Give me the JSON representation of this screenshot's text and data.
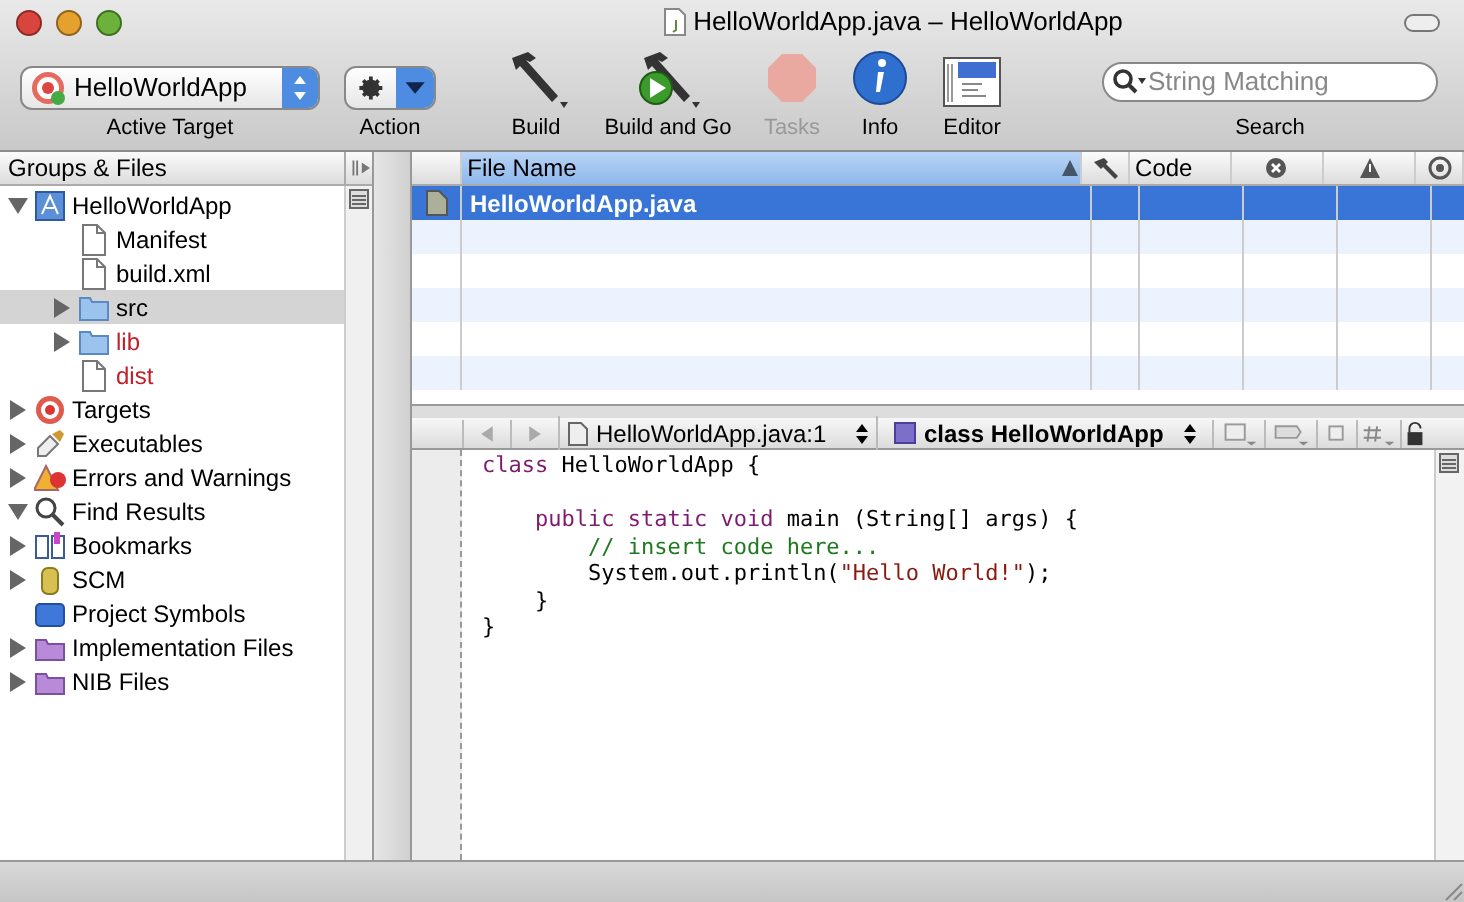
{
  "window": {
    "title": "HelloWorldApp.java – HelloWorldApp"
  },
  "toolbar": {
    "items": [
      {
        "kind": "target_popup",
        "value": "HelloWorldApp",
        "label": "Active Target",
        "disabled": false
      },
      {
        "kind": "action_popup",
        "label": "Action",
        "disabled": false
      },
      {
        "kind": "build",
        "label": "Build",
        "disabled": false
      },
      {
        "kind": "build_go",
        "label": "Build and Go",
        "disabled": false
      },
      {
        "kind": "tasks",
        "label": "Tasks",
        "disabled": true
      },
      {
        "kind": "info",
        "label": "Info",
        "disabled": false
      },
      {
        "kind": "editor",
        "label": "Editor",
        "disabled": false
      },
      {
        "kind": "search",
        "placeholder": "String Matching",
        "label": "Search",
        "disabled": false
      }
    ]
  },
  "sidebar": {
    "title": "Groups & Files",
    "items": [
      {
        "label": "HelloWorldApp",
        "kind": "project",
        "expanded": true,
        "selected": false,
        "missing": false,
        "children": [
          {
            "label": "Manifest",
            "kind": "file",
            "selected": false,
            "missing": false
          },
          {
            "label": "build.xml",
            "kind": "file",
            "selected": false,
            "missing": false
          },
          {
            "label": "src",
            "kind": "folder",
            "expanded": false,
            "selected": true,
            "missing": false
          },
          {
            "label": "lib",
            "kind": "folder",
            "expanded": false,
            "selected": false,
            "missing": true
          },
          {
            "label": "dist",
            "kind": "file",
            "selected": false,
            "missing": true
          }
        ]
      },
      {
        "label": "Targets",
        "kind": "target",
        "expanded": false,
        "selected": false,
        "missing": false
      },
      {
        "label": "Executables",
        "kind": "executables",
        "expanded": false,
        "selected": false,
        "missing": false
      },
      {
        "label": "Errors and Warnings",
        "kind": "warnings",
        "expanded": false,
        "selected": false,
        "missing": false
      },
      {
        "label": "Find Results",
        "kind": "find",
        "expanded": true,
        "selected": false,
        "missing": false
      },
      {
        "label": "Bookmarks",
        "kind": "bookmarks",
        "expanded": false,
        "selected": false,
        "missing": false
      },
      {
        "label": "SCM",
        "kind": "scm",
        "expanded": false,
        "selected": false,
        "missing": false
      },
      {
        "label": "Project Symbols",
        "kind": "symbols",
        "selected": false,
        "missing": false
      },
      {
        "label": "Implementation Files",
        "kind": "smartgroup",
        "expanded": false,
        "selected": false,
        "missing": false
      },
      {
        "label": "NIB Files",
        "kind": "smartgroup",
        "expanded": false,
        "selected": false,
        "missing": false
      }
    ]
  },
  "file_table": {
    "columns": [
      {
        "kind": "text",
        "label": "File Name",
        "selected": true
      },
      {
        "kind": "hammer",
        "selected": false
      },
      {
        "kind": "text",
        "label": "Code",
        "selected": false
      },
      {
        "kind": "error",
        "selected": false
      },
      {
        "kind": "warning",
        "selected": false
      },
      {
        "kind": "target",
        "selected": false
      }
    ],
    "rows": [
      {
        "file": "HelloWorldApp.java",
        "selected": true
      }
    ]
  },
  "editor": {
    "file_popup": "HelloWorldApp.java:1",
    "symbol_popup": "class HelloWorldApp",
    "lines": [
      {
        "kind": "code",
        "segments": [
          {
            "kind": "keyword",
            "text": "class"
          },
          {
            "kind": "plain",
            "text": " HelloWorldApp {"
          }
        ]
      },
      {
        "kind": "blank"
      },
      {
        "kind": "code",
        "segments": [
          {
            "kind": "keyword",
            "text": "    public static void"
          },
          {
            "kind": "plain",
            "text": " main (String[] args) {"
          }
        ]
      },
      {
        "kind": "code",
        "segments": [
          {
            "kind": "comment",
            "text": "        // insert code here..."
          }
        ]
      },
      {
        "kind": "code",
        "segments": [
          {
            "kind": "plain",
            "text": "        System.out.println("
          },
          {
            "kind": "string",
            "text": "\"Hello World!\""
          },
          {
            "kind": "plain",
            "text": ");"
          }
        ]
      },
      {
        "kind": "code",
        "segments": [
          {
            "kind": "plain",
            "text": "    }"
          }
        ]
      },
      {
        "kind": "code",
        "segments": [
          {
            "kind": "plain",
            "text": "}"
          }
        ]
      }
    ]
  }
}
